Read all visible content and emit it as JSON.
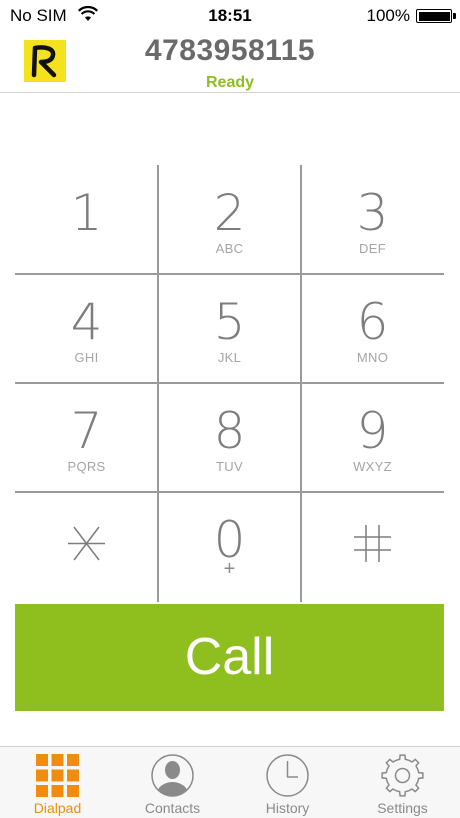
{
  "status_bar": {
    "carrier": "No SIM",
    "time": "18:51",
    "battery_percent": "100%",
    "battery_level": 1.0
  },
  "header": {
    "logo_letter": "R",
    "phone_number": "4783958115",
    "status": "Ready"
  },
  "dialpad": {
    "keys": [
      {
        "digit": "1",
        "letters": ""
      },
      {
        "digit": "2",
        "letters": "ABC"
      },
      {
        "digit": "3",
        "letters": "DEF"
      },
      {
        "digit": "4",
        "letters": "GHI"
      },
      {
        "digit": "5",
        "letters": "JKL"
      },
      {
        "digit": "6",
        "letters": "MNO"
      },
      {
        "digit": "7",
        "letters": "PQRS"
      },
      {
        "digit": "8",
        "letters": "TUV"
      },
      {
        "digit": "9",
        "letters": "WXYZ"
      },
      {
        "symbol": "star-icon"
      },
      {
        "digit": "0",
        "letters": "+"
      },
      {
        "symbol": "hash-icon"
      }
    ]
  },
  "call_button": {
    "label": "Call"
  },
  "tabs": [
    {
      "label": "Dialpad",
      "icon": "dialpad-grid-icon",
      "active": true
    },
    {
      "label": "Contacts",
      "icon": "contact-person-icon",
      "active": false
    },
    {
      "label": "History",
      "icon": "clock-icon",
      "active": false
    },
    {
      "label": "Settings",
      "icon": "gear-icon",
      "active": false
    }
  ],
  "colors": {
    "accent_green": "#8ebf1f",
    "accent_orange": "#ef8c12",
    "logo_yellow": "#f5e21f"
  }
}
